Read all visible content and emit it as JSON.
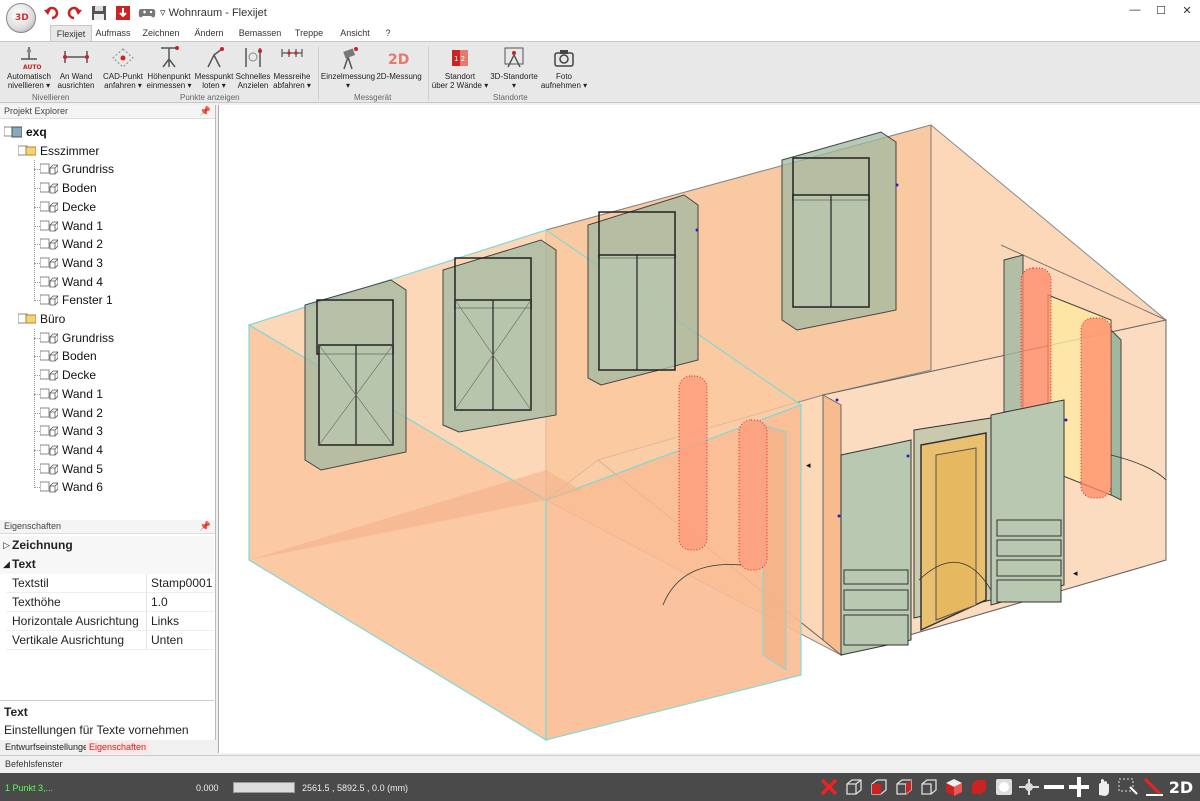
{
  "window": {
    "title": "Wohnraum - Flexijet",
    "logo_text": "3D"
  },
  "quick_access": [
    "undo-icon",
    "redo-icon",
    "save-icon",
    "import-icon",
    "gamepad-icon"
  ],
  "tabs": [
    "Flexijet",
    "Aufmass",
    "Zeichnen",
    "Ändern",
    "Bemassen",
    "Treppe",
    "Ansicht",
    "?"
  ],
  "ribbon": {
    "buttons": [
      {
        "label1": "Automatisch",
        "label2": "nivellieren ▾",
        "icon": "auto-level-icon"
      },
      {
        "label1": "An Wand",
        "label2": "ausrichten",
        "icon": "align-wall-icon"
      },
      {
        "label1": "CAD-Punkt",
        "label2": "anfahren ▾",
        "icon": "cad-point-icon"
      },
      {
        "label1": "Höhenpunkt",
        "label2": "einmessen ▾",
        "icon": "height-point-icon"
      },
      {
        "label1": "Messpunkt",
        "label2": "loten ▾",
        "icon": "plumb-point-icon"
      },
      {
        "label1": "Schnelles",
        "label2": "Anzielen",
        "icon": "quick-aim-icon"
      },
      {
        "label1": "Messreihe",
        "label2": "abfahren ▾",
        "icon": "measure-series-icon"
      },
      {
        "label1": "Einzelmessung",
        "label2": "▾",
        "icon": "single-measure-icon"
      },
      {
        "label1": "2D-Messung",
        "label2": "",
        "icon": "measure-2d-icon"
      },
      {
        "label1": "Standort",
        "label2": "über 2 Wände ▾",
        "icon": "location-2-walls-icon"
      },
      {
        "label1": "3D-Standorte",
        "label2": "▾",
        "icon": "locations-3d-icon"
      },
      {
        "label1": "Foto",
        "label2": "aufnehmen ▾",
        "icon": "camera-icon"
      }
    ],
    "groups": [
      "Nivellieren",
      "Punkte anzeigen",
      "Messgerät",
      "Standorte"
    ]
  },
  "explorer": {
    "title": "Projekt Explorer",
    "root": "exq",
    "rooms": [
      {
        "name": "Esszimmer",
        "items": [
          "Grundriss",
          "Boden",
          "Decke",
          "Wand 1",
          "Wand 2",
          "Wand 3",
          "Wand 4",
          "Fenster 1"
        ]
      },
      {
        "name": "Büro",
        "items": [
          "Grundriss",
          "Boden",
          "Decke",
          "Wand 1",
          "Wand 2",
          "Wand 3",
          "Wand 4",
          "Wand 5",
          "Wand 6"
        ]
      }
    ]
  },
  "properties": {
    "title": "Eigenschaften",
    "categories": [
      "Zeichnung",
      "Text"
    ],
    "rows": [
      {
        "key": "Textstil",
        "value": "Stamp0001"
      },
      {
        "key": "Texthöhe",
        "value": "1.0"
      },
      {
        "key": "Horizontale Ausrichtung",
        "value": "Links"
      },
      {
        "key": "Vertikale Ausrichtung",
        "value": "Unten"
      }
    ],
    "desc_title": "Text",
    "desc_text": "Einstellungen für Texte vornehmen"
  },
  "bottom_tabs": [
    "Entwurfseinstellungen",
    "Eigenschaften"
  ],
  "command_window": {
    "label": "Befehlsfenster"
  },
  "status": {
    "left": "1 Punkt 3,...",
    "value": "0.000",
    "coords": "2561.5 , 5892.5 , 0.0 (mm)",
    "mode": "2D"
  },
  "colors": {
    "wall_fill": "#fbc9a0",
    "wall_edge": "#7fd8d8",
    "accent_red": "#d22",
    "ribbon_bg": "#e8e8e8",
    "status_bg": "#4a4a4a"
  }
}
